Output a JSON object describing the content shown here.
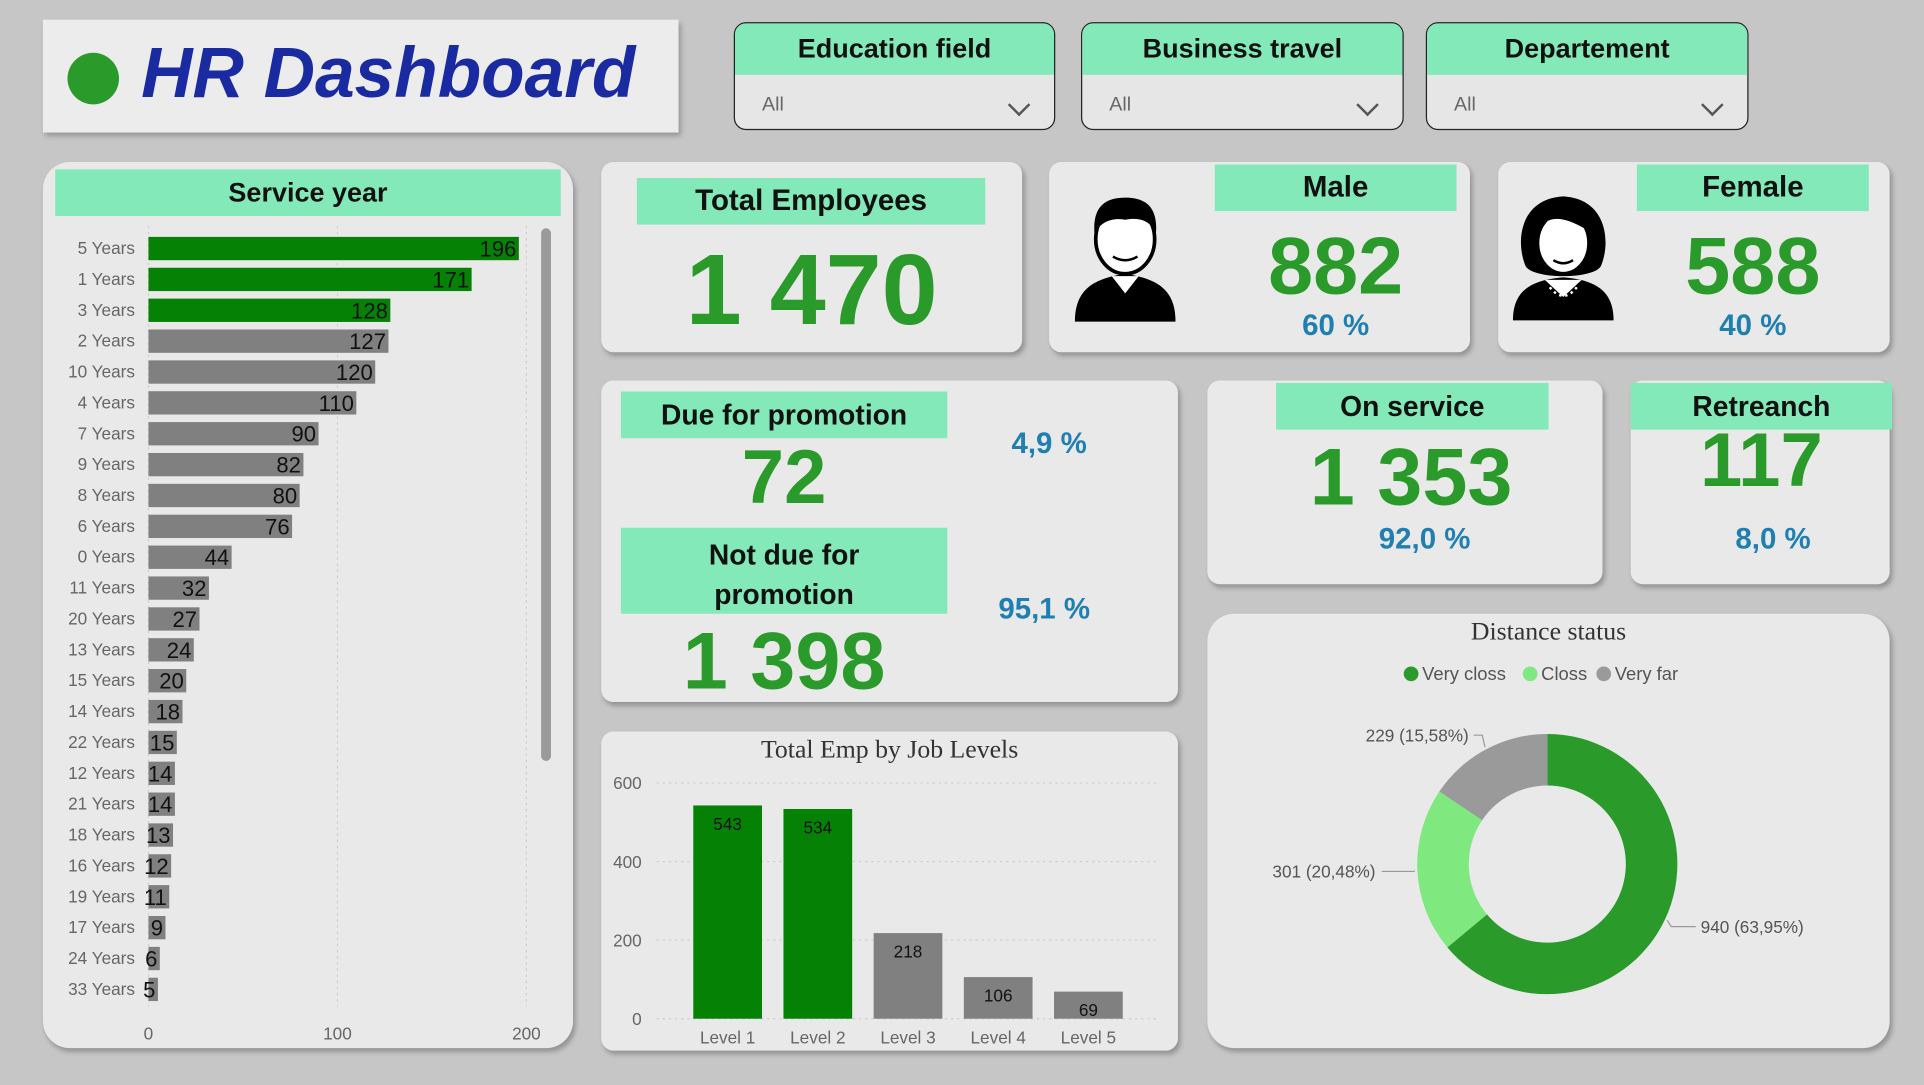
{
  "title": "HR Dashboard",
  "colors": {
    "accent": "#84e9b8",
    "dark_green": "#058205",
    "gray_bar": "#808080",
    "kpi_green": "#2a9a2a",
    "pct_blue": "#1f7fb0",
    "title_blue": "#1a2aa0"
  },
  "filters": [
    {
      "label": "Education field",
      "value": "All"
    },
    {
      "label": "Business travel",
      "value": "All"
    },
    {
      "label": "Departement",
      "value": "All"
    }
  ],
  "kpis": {
    "total_employees": {
      "label": "Total Employees",
      "value": "1 470"
    },
    "male": {
      "label": "Male",
      "value": "882",
      "pct": "60 %",
      "icon": "male-person-icon"
    },
    "female": {
      "label": "Female",
      "value": "588",
      "pct": "40 %",
      "icon": "female-person-icon"
    },
    "promotion": {
      "due_label": "Due for promotion",
      "due_value": "72",
      "due_pct": "4,9 %",
      "not_due_label": "Not due for promotion",
      "not_due_value": "1 398",
      "not_due_pct": "95,1 %"
    },
    "on_service": {
      "label": "On service",
      "value": "1 353",
      "pct": "92,0 %"
    },
    "retreanch": {
      "label": "Retreanch",
      "value": "117",
      "pct": "8,0 %"
    }
  },
  "chart_data": [
    {
      "type": "bar",
      "orientation": "horizontal",
      "title": "Service year",
      "categories": [
        "5 Years",
        "1 Years",
        "3 Years",
        "2 Years",
        "10 Years",
        "4 Years",
        "7 Years",
        "9 Years",
        "8 Years",
        "6 Years",
        "0 Years",
        "11 Years",
        "20 Years",
        "13 Years",
        "15 Years",
        "14 Years",
        "22 Years",
        "12 Years",
        "21 Years",
        "18 Years",
        "16 Years",
        "19 Years",
        "17 Years",
        "24 Years",
        "33 Years"
      ],
      "values": [
        196,
        171,
        128,
        127,
        120,
        110,
        90,
        82,
        80,
        76,
        44,
        32,
        27,
        24,
        20,
        18,
        15,
        14,
        14,
        13,
        12,
        11,
        9,
        6,
        5
      ],
      "highlighted_top": 3,
      "xticks": [
        0,
        100,
        200
      ],
      "xlim": [
        0,
        200
      ],
      "grid": true
    },
    {
      "type": "bar",
      "title": "Total Emp by Job Levels",
      "categories": [
        "Level 1",
        "Level 2",
        "Level 3",
        "Level 4",
        "Level 5"
      ],
      "values": [
        543,
        534,
        218,
        106,
        69
      ],
      "highlighted_top": 2,
      "yticks": [
        0,
        200,
        400,
        600
      ],
      "ylim": [
        0,
        600
      ],
      "grid": true
    },
    {
      "type": "pie",
      "donut": true,
      "title": "Distance status",
      "legend_position": "top",
      "slices": [
        {
          "name": "Very closs",
          "value": 940,
          "label": "940 (63,95%)",
          "color": "#2a9a2a"
        },
        {
          "name": "Closs",
          "value": 301,
          "label": "301 (20,48%)",
          "color": "#7fe87f"
        },
        {
          "name": "Very far",
          "value": 229,
          "label": "229 (15,58%)",
          "color": "#9a9a9a"
        }
      ]
    }
  ]
}
